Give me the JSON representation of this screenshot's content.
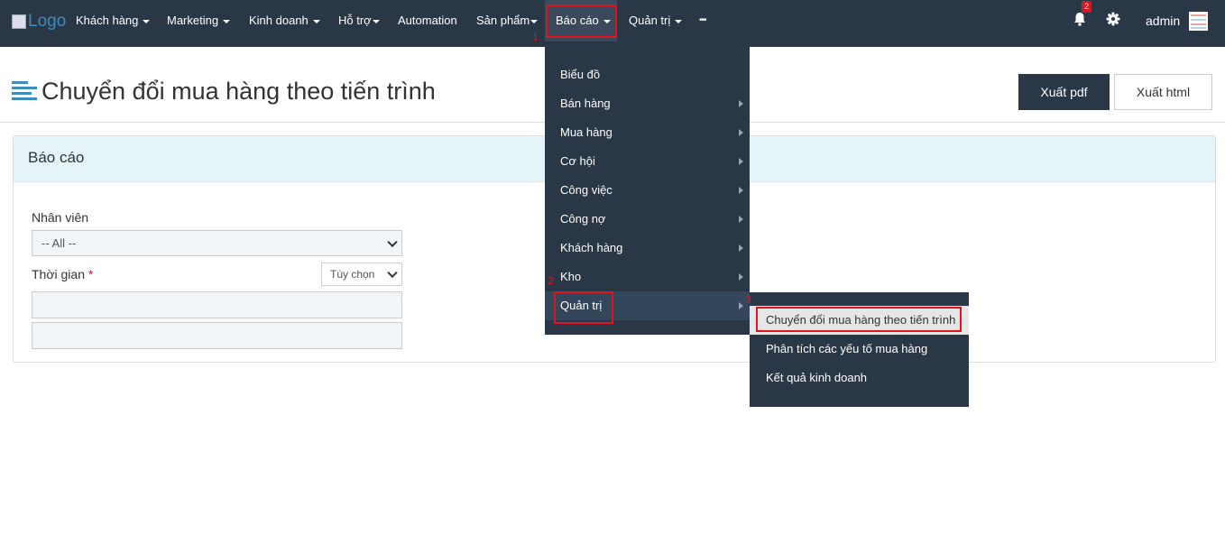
{
  "navbar": {
    "logo_alt": "Logo",
    "items": [
      "Khách hàng",
      "Marketing",
      "Kinh doanh",
      "Hỗ trợ",
      "Automation",
      "Sản phẩm",
      "Báo cáo",
      "Quản trị",
      "•••"
    ],
    "notification_count": "2",
    "user": "admin"
  },
  "page": {
    "title": "Chuyển đổi mua hàng theo tiến trình",
    "buttons": {
      "export_pdf": "Xuất pdf",
      "export_html": "Xuất html"
    }
  },
  "panel": {
    "title": "Báo cáo",
    "employee_label": "Nhân viên",
    "employee_value": "-- All --",
    "time_label": "Thời gian",
    "required_mark": "*",
    "time_mode": "Tùy chọn"
  },
  "dropdown": {
    "items": [
      "Biểu đồ",
      "Bán hàng",
      "Mua hàng",
      "Cơ hội",
      "Công việc",
      "Công nợ",
      "Khách hàng",
      "Kho",
      "Quản trị"
    ]
  },
  "submenu": {
    "items": [
      "Chuyển đổi mua hàng theo tiến trình",
      "Phân tích các yếu tố mua hàng",
      "Kết quả kinh doanh"
    ]
  },
  "annotations": {
    "step1": "1",
    "step2": "2",
    "step3": "3"
  },
  "colors": {
    "navbar": "#2a3747",
    "accent": "#3c8dbc",
    "highlight": "#e0141e",
    "panel_header": "#e4f4f8"
  }
}
